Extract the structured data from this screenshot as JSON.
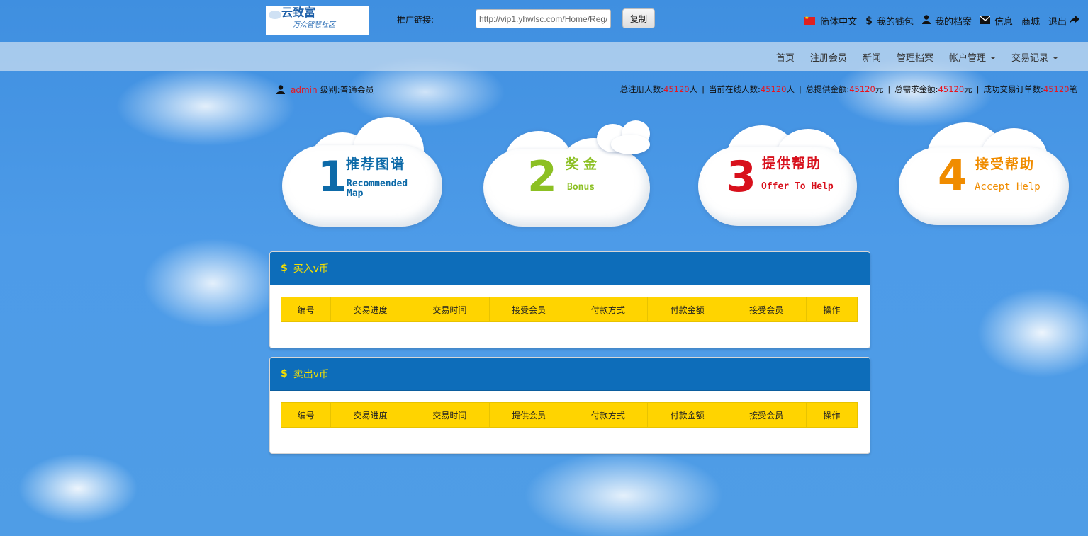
{
  "header": {
    "logo": {
      "line1": "云致富",
      "line2": "万众智慧社区"
    },
    "promo_label": "推广链接:",
    "promo_value": "http://vip1.yhwlsc.com/Home/Reg/",
    "copy_label": "复制",
    "links": [
      {
        "label": "简体中文",
        "icon": "china-flag-icon"
      },
      {
        "label": "我的钱包",
        "icon": "dollar-icon"
      },
      {
        "label": "我的档案",
        "icon": "user-icon"
      },
      {
        "label": "信息",
        "icon": "envelope-icon"
      },
      {
        "label": "商城",
        "icon": ""
      },
      {
        "label": "退出",
        "icon": "share-arrow-icon"
      }
    ]
  },
  "nav": {
    "items": [
      "首页",
      "注册会员",
      "新闻",
      "管理档案",
      "帐户管理",
      "交易记录"
    ]
  },
  "user": {
    "name": "admin",
    "level_label": "级别:普通会员"
  },
  "stats": {
    "registered_label": "总注册人数:",
    "registered_value": "45120",
    "registered_unit": "人",
    "online_label": "当前在线人数:",
    "online_value": "45120",
    "online_unit": "人",
    "supply_label": "总提供金额:",
    "supply_value": "45120",
    "supply_unit": "元",
    "demand_label": "总需求金额:",
    "demand_value": "45120",
    "demand_unit": "元",
    "orders_label": "成功交易订单数:",
    "orders_value": "45120",
    "orders_unit": "笔"
  },
  "clouds": [
    {
      "num": "1",
      "title": "推荐图谱",
      "sub": "Recommended Map",
      "color": "#0d6aa8"
    },
    {
      "num": "2",
      "title": "奖金",
      "sub": "Bonus",
      "color": "#8cc023"
    },
    {
      "num": "3",
      "title": "提供帮助",
      "sub": "Offer To Help",
      "color": "#d8101c"
    },
    {
      "num": "4",
      "title": "接受帮助",
      "sub": "Accept Help",
      "color": "#f08c00"
    }
  ],
  "buy_panel": {
    "title": "买入v币",
    "columns": [
      "编号",
      "交易进度",
      "交易时间",
      "接受会员",
      "付款方式",
      "付款金额",
      "接受会员",
      "操作"
    ]
  },
  "sell_panel": {
    "title": "卖出v币",
    "columns": [
      "编号",
      "交易进度",
      "交易时间",
      "提供会员",
      "付款方式",
      "付款金额",
      "接受会员",
      "操作"
    ]
  },
  "colors": {
    "panel_header": "#0d6dba",
    "panel_title": "#f5e000",
    "table_header": "#ffd400",
    "highlight": "#e8141e"
  }
}
